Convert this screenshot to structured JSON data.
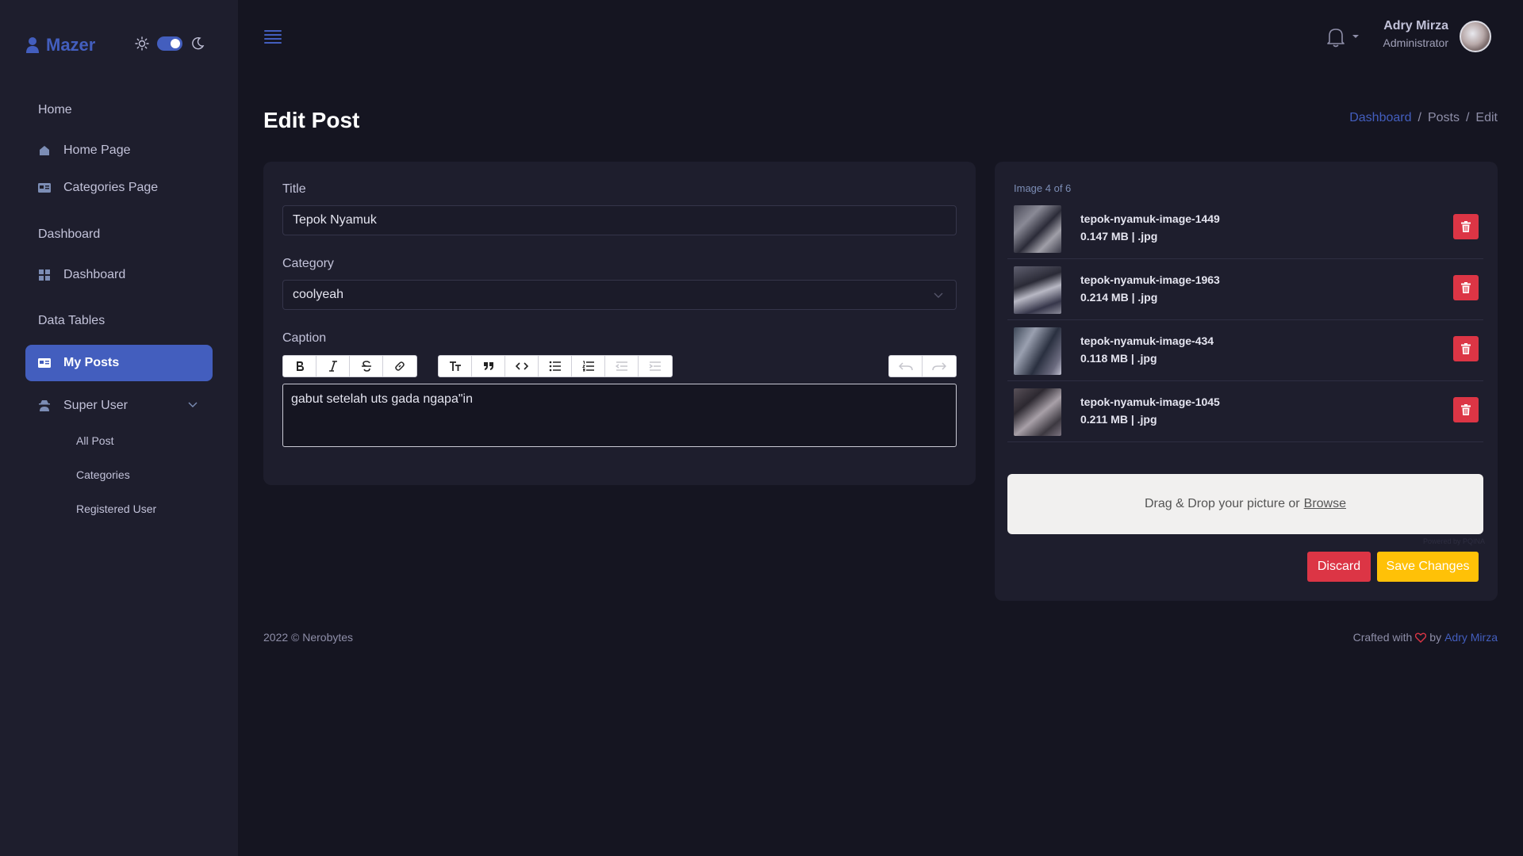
{
  "brand": {
    "name": "Mazer"
  },
  "sidebar": {
    "sections": [
      {
        "title": "Home"
      },
      {
        "title": "Dashboard"
      },
      {
        "title": "Data Tables"
      }
    ],
    "items": [
      {
        "label": "Home Page",
        "icon": "house-icon"
      },
      {
        "label": "Categories Page",
        "icon": "card-icon"
      },
      {
        "label": "Dashboard",
        "icon": "grid-icon"
      },
      {
        "label": "My Posts",
        "icon": "card-icon",
        "active": true
      },
      {
        "label": "Super User",
        "icon": "user-secret-icon"
      }
    ],
    "submenu": [
      "All Post",
      "Categories",
      "Registered User"
    ]
  },
  "header": {
    "user_name": "Adry Mirza",
    "user_role": "Administrator"
  },
  "page": {
    "title": "Edit Post",
    "breadcrumb": [
      "Dashboard",
      "/",
      "Posts",
      "/",
      "Edit"
    ]
  },
  "form": {
    "title_label": "Title",
    "title_value": "Tepok Nyamuk",
    "category_label": "Category",
    "category_value": "coolyeah",
    "caption_label": "Caption",
    "caption_value": "gabut setelah uts gada ngapa\"in"
  },
  "uploads": {
    "counter": "Image 4 of 6",
    "files": [
      {
        "name": "tepok-nyamuk-image-1449",
        "meta": "0.147 MB | .jpg"
      },
      {
        "name": "tepok-nyamuk-image-1963",
        "meta": "0.214 MB | .jpg"
      },
      {
        "name": "tepok-nyamuk-image-434",
        "meta": "0.118 MB | .jpg"
      },
      {
        "name": "tepok-nyamuk-image-1045",
        "meta": "0.211 MB | .jpg"
      }
    ],
    "dropzone_text": "Drag & Drop your picture or",
    "dropzone_link": "Browse",
    "powered_by": "Powered by PQINA",
    "discard_label": "Discard",
    "save_label": "Save Changes"
  },
  "footer": {
    "copyright": "2022 © Nerobytes",
    "crafted": "Crafted with",
    "by": "by",
    "author": "Adry Mirza"
  },
  "colors": {
    "primary": "#435ebe",
    "danger": "#dc3545",
    "warning": "#ffc107",
    "background": "#151521",
    "card": "#1e1e2d"
  }
}
